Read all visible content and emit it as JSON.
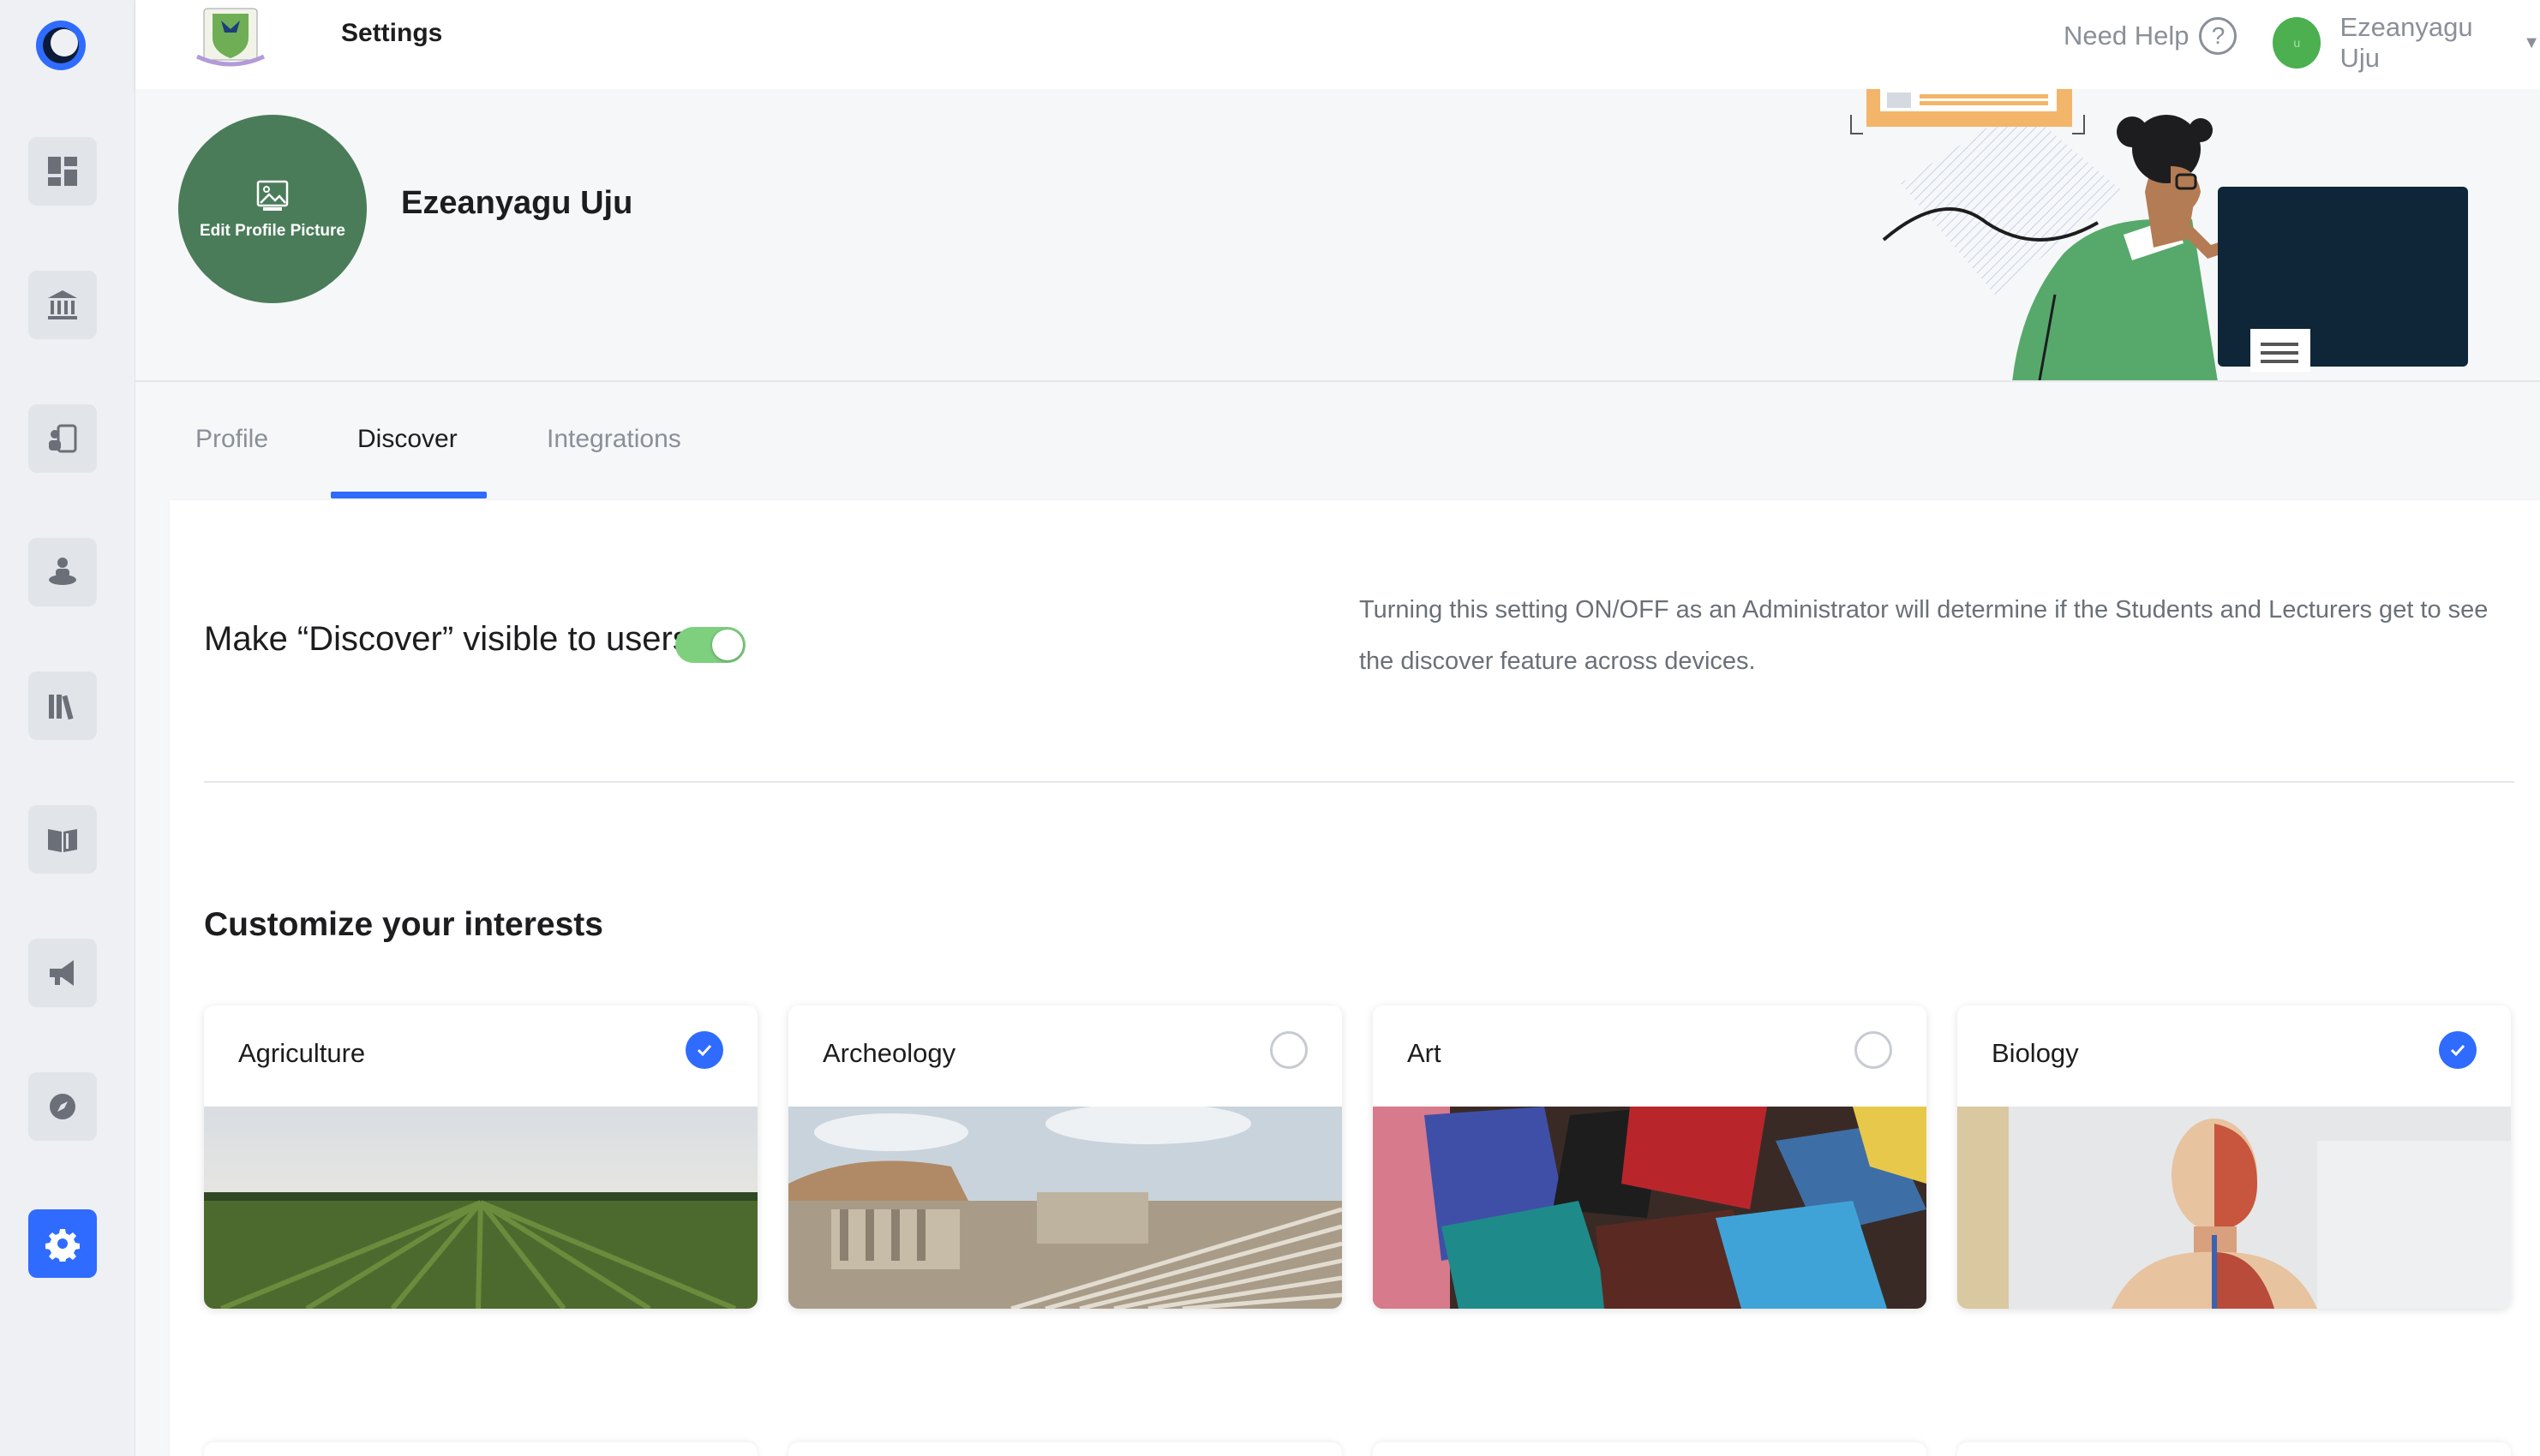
{
  "header": {
    "page_title": "Settings",
    "help_label": "Need Help",
    "help_symbol": "?",
    "user_name": "Ezeanyagu Uju",
    "avatar_initial": "u"
  },
  "rail": {
    "items": [
      "dashboard-icon",
      "institution-icon",
      "student-id-icon",
      "lecturer-icon",
      "library-icon",
      "book-icon",
      "announcement-icon",
      "discover-icon",
      "settings-icon"
    ],
    "active": "settings-icon",
    "accent": "#2f6bff"
  },
  "profile": {
    "edit_picture_label": "Edit Profile Picture",
    "name": "Ezeanyagu Uju",
    "picture_color": "#4a7c59"
  },
  "tabs": [
    {
      "label": "Profile",
      "active": false
    },
    {
      "label": "Discover",
      "active": true
    },
    {
      "label": "Integrations",
      "active": false
    }
  ],
  "discover": {
    "toggle_label": "Make “Discover” visible to users",
    "toggle_on": true,
    "toggle_color": "#7ed07f",
    "description": "Turning this setting ON/OFF as an Administrator will determine if the Students and Lecturers get to see the discover feature across devices."
  },
  "interests": {
    "title": "Customize your interests",
    "items": [
      {
        "label": "Agriculture",
        "selected": true
      },
      {
        "label": "Archeology",
        "selected": false
      },
      {
        "label": "Art",
        "selected": false
      },
      {
        "label": "Biology",
        "selected": true
      }
    ]
  }
}
